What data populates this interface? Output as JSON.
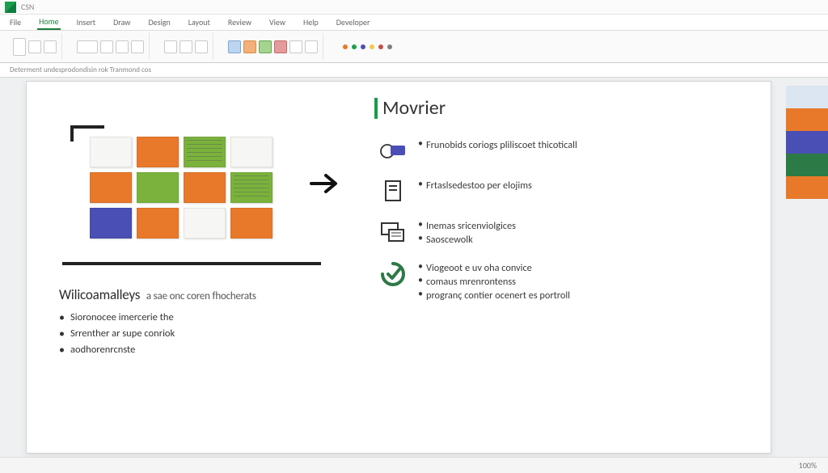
{
  "titlebar": {
    "doc_title": "CSN"
  },
  "ribbon_tabs": [
    "File",
    "Home",
    "Insert",
    "Draw",
    "Design",
    "Layout",
    "Review",
    "View",
    "Help",
    "Developer"
  ],
  "ribbon_tabs_active_index": 1,
  "subheader_text": "Determent undesprodondisin rok Tranmond cos",
  "slide": {
    "left": {
      "title_line1": "Wilicoamalleys",
      "title_line2": "a sae onc coren fhocherats",
      "bullets": [
        "Sioronocee imercerie the",
        "Srrenther ar supe conriok",
        "aodhorenrcnste"
      ]
    },
    "right": {
      "title": "Movrier",
      "features": [
        {
          "icon": "chat-bubble",
          "lines": [
            "Frunobids coriogs pliliscoet thicoticall"
          ]
        },
        {
          "icon": "page-outline",
          "lines": [
            "Frtaslsedestoo per elojims"
          ]
        },
        {
          "icon": "devices-stack",
          "lines": [
            "Inemas sricenviolgices",
            "Saoscewolk"
          ]
        },
        {
          "icon": "checkmark-circle",
          "lines": [
            "Viogeoot e uv oha convice",
            "comaus mrenrontenss",
            "progranç contier ocenert es portroll"
          ]
        }
      ]
    }
  },
  "palette_colors": [
    "#dbe6f2",
    "#e9792a",
    "#4a4fb5",
    "#2c7a45",
    "#e9792a"
  ],
  "statusbar": {
    "zoom": "100%"
  },
  "ribbon_color_dots": [
    "#e9792a",
    "#1b9e4b",
    "#4a4fb5",
    "#f2c94c",
    "#c0504d",
    "#7f7f7f"
  ]
}
